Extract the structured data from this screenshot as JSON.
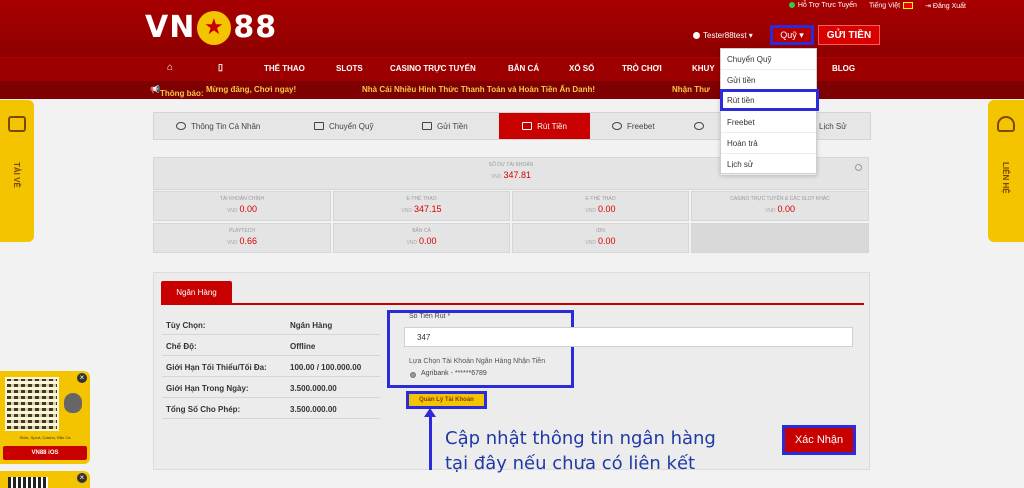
{
  "header": {
    "logo_left": "VN",
    "logo_right": "88",
    "top_links": [
      "Hỗ Trợ Trực Tuyến",
      "Tiếng Việt",
      "Đăng Xuất"
    ],
    "username": "Tester88test",
    "fund_button": "Quỹ",
    "deposit_button": "GỬI TIỀN"
  },
  "nav": {
    "items": [
      "THỂ THAO",
      "SLOTS",
      "CASINO TRỰC TUYẾN",
      "BẮN CÁ",
      "XỔ SỐ",
      "TRÒ CHƠI",
      "KHUY",
      "BLOG"
    ]
  },
  "ticker": {
    "label": "Thông báo:",
    "messages": [
      "Mừng đăng, Chơi ngay!",
      "Nhà Cái Nhiều Hình Thức Thanh Toán và Hoàn Tiền Ấn Danh!",
      "Nhận Thư"
    ]
  },
  "side": {
    "left": "TẢI VỀ",
    "right": "LIÊN HỆ"
  },
  "tabs": [
    {
      "label": "Thông Tin Cá Nhân"
    },
    {
      "label": "Chuyển Quỹ"
    },
    {
      "label": "Gửi Tiền"
    },
    {
      "label": "Rút Tiền"
    },
    {
      "label": "Freebet"
    },
    {
      "label": "Lịch Sử"
    }
  ],
  "dropdown": {
    "items": [
      "Chuyển Quỹ",
      "Gửi tiền",
      "Rút tiền",
      "Freebet",
      "Hoàn trả",
      "Lịch sử"
    ]
  },
  "balance": {
    "main": {
      "label": "SỐ DƯ TÀI KHOẢN",
      "currency": "VND",
      "value": "347.81"
    },
    "cells": [
      {
        "label": "TÀI KHOẢN CHÍNH",
        "currency": "VND",
        "value": "0.00"
      },
      {
        "label": "E-THỂ THAO",
        "currency": "VND",
        "value": "347.15"
      },
      {
        "label": "E-THỂ THAO",
        "currency": "VND",
        "value": "0.00"
      },
      {
        "label": "CASINO TRỰC TUYẾN & CÁC SLOT KHÁC",
        "currency": "VND",
        "value": "0.00"
      },
      {
        "label": "PLAYTECH",
        "currency": "VND",
        "value": "0.66"
      },
      {
        "label": "BẮN CÁ",
        "currency": "VND",
        "value": "0.00"
      },
      {
        "label": "IDN",
        "currency": "VND",
        "value": "0.00"
      }
    ]
  },
  "withdraw": {
    "tab_label": "Ngân Hàng",
    "info": [
      {
        "key": "Tùy Chọn:",
        "value": "Ngân Hàng"
      },
      {
        "key": "Chế Độ:",
        "value": "Offline"
      },
      {
        "key": "Giới Hạn Tối Thiểu/Tối Đa:",
        "value": "100.00 / 100.000.00"
      },
      {
        "key": "Giới Hạn Trong Ngày:",
        "value": "3.500.000.00"
      },
      {
        "key": "Tổng Số Cho Phép:",
        "value": "3.500.000.00"
      }
    ],
    "amount_label": "Số Tiền Rút *",
    "amount_value": "347",
    "account_label": "Lựa Chọn Tài Khoản Ngân Hàng Nhận Tiền",
    "account_value": "Agribank - ******6789",
    "manage_button": "Quản Lý Tài Khoản",
    "confirm_button": "Xác Nhận"
  },
  "annotation": {
    "line1": "Cập nhật thông tin ngân hàng",
    "line2": "tại đây nếu chưa có liên kết"
  },
  "qr": {
    "subtitle": "Slots, Sport, Casino, Bắn Cá",
    "title": "VN88 iOS"
  },
  "colors": {
    "brand_red": "#c80000",
    "header_red": "#a80000",
    "accent_yellow": "#f5c400",
    "highlight_blue": "#2b2bd9"
  }
}
